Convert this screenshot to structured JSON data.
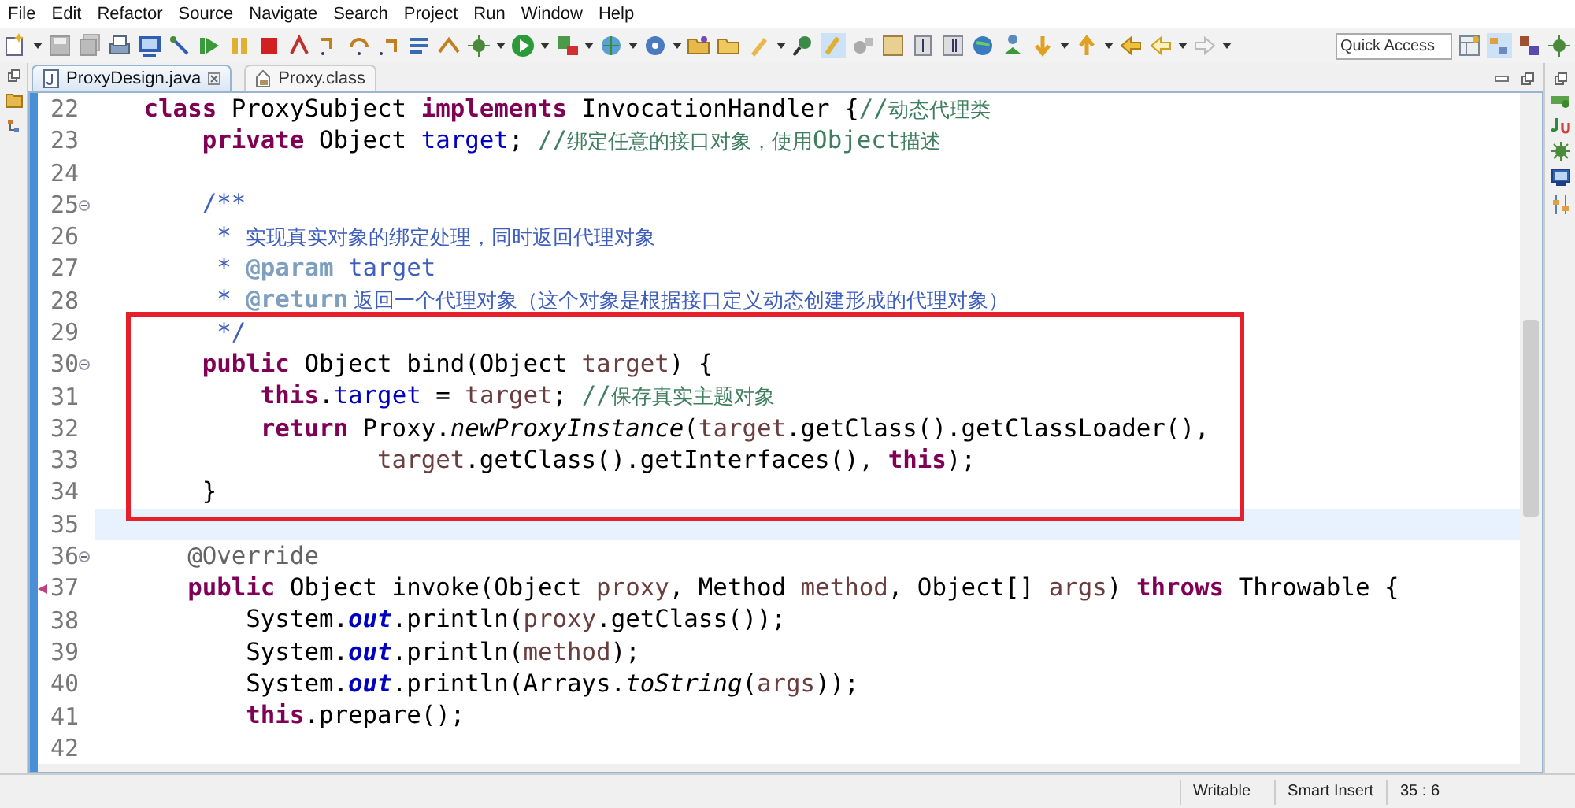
{
  "menu": [
    "File",
    "Edit",
    "Refactor",
    "Source",
    "Navigate",
    "Search",
    "Project",
    "Run",
    "Window",
    "Help"
  ],
  "quick_access": {
    "placeholder": "Quick Access"
  },
  "tabs": [
    {
      "label": "ProxyDesign.java",
      "selected": true,
      "closable": true,
      "kind": "java"
    },
    {
      "label": "Proxy.class",
      "selected": false,
      "closable": false,
      "kind": "class"
    }
  ],
  "editor": {
    "lines": [
      {
        "number": "22",
        "fold": false,
        "override": false,
        "current": false,
        "boxed": false,
        "segments": [
          {
            "kind": "k",
            "text": " class"
          },
          {
            "kind": "p",
            "text": " ProxySubject "
          },
          {
            "kind": "k",
            "text": "implements"
          },
          {
            "kind": "p",
            "text": " InvocationHandler {"
          },
          {
            "kind": "c",
            "text": "//"
          },
          {
            "kind": "cc",
            "text": "动态代理类"
          }
        ]
      },
      {
        "number": "23",
        "fold": false,
        "override": false,
        "current": false,
        "boxed": false,
        "segments": [
          {
            "kind": "k",
            "text": "     private"
          },
          {
            "kind": "p",
            "text": " Object "
          },
          {
            "kind": "f",
            "text": "target"
          },
          {
            "kind": "p",
            "text": "; "
          },
          {
            "kind": "c",
            "text": "//"
          },
          {
            "kind": "cc",
            "text": "绑定任意的接口对象，使用"
          },
          {
            "kind": "c",
            "text": "Object"
          },
          {
            "kind": "cc",
            "text": "描述"
          }
        ]
      },
      {
        "number": "24",
        "fold": false,
        "override": false,
        "current": false,
        "boxed": false
      },
      {
        "number": "25",
        "fold": true,
        "override": false,
        "current": false,
        "boxed": false,
        "segments": [
          {
            "kind": "j",
            "text": "     /**"
          }
        ]
      },
      {
        "number": "26",
        "fold": false,
        "override": false,
        "current": false,
        "boxed": false,
        "segments": [
          {
            "kind": "j",
            "text": "      * "
          },
          {
            "kind": "jc",
            "text": "实现真实对象的绑定处理，同时返回代理对象"
          }
        ]
      },
      {
        "number": "27",
        "fold": false,
        "override": false,
        "current": false,
        "boxed": false,
        "segments": [
          {
            "kind": "j",
            "text": "      * "
          },
          {
            "kind": "jt",
            "text": "@param"
          },
          {
            "kind": "j",
            "text": " target"
          }
        ]
      },
      {
        "number": "28",
        "fold": false,
        "override": false,
        "current": false,
        "boxed": false,
        "segments": [
          {
            "kind": "j",
            "text": "      * "
          },
          {
            "kind": "jt",
            "text": "@return"
          },
          {
            "kind": "jc",
            "text": " 返回一个代理对象（这个对象是根据接口定义动态创建形成的代理对象）"
          }
        ]
      },
      {
        "number": "29",
        "fold": false,
        "override": false,
        "current": false,
        "boxed": true,
        "segments": [
          {
            "kind": "j",
            "text": "      */"
          }
        ]
      },
      {
        "number": "30",
        "fold": true,
        "override": false,
        "current": false,
        "boxed": true,
        "segments": [
          {
            "kind": "k",
            "text": "     public"
          },
          {
            "kind": "p",
            "text": " Object bind(Object "
          },
          {
            "kind": "v",
            "text": "target"
          },
          {
            "kind": "p",
            "text": ") {"
          }
        ]
      },
      {
        "number": "31",
        "fold": false,
        "override": false,
        "current": false,
        "boxed": true,
        "segments": [
          {
            "kind": "k",
            "text": "         this"
          },
          {
            "kind": "p",
            "text": "."
          },
          {
            "kind": "f",
            "text": "target"
          },
          {
            "kind": "p",
            "text": " = "
          },
          {
            "kind": "v",
            "text": "target"
          },
          {
            "kind": "p",
            "text": "; "
          },
          {
            "kind": "c",
            "text": "//"
          },
          {
            "kind": "cc",
            "text": "保存真实主题对象"
          }
        ]
      },
      {
        "number": "32",
        "fold": false,
        "override": false,
        "current": false,
        "boxed": true,
        "segments": [
          {
            "kind": "k",
            "text": "         return"
          },
          {
            "kind": "p",
            "text": " Proxy."
          },
          {
            "kind": "im",
            "text": "newProxyInstance"
          },
          {
            "kind": "p",
            "text": "("
          },
          {
            "kind": "v",
            "text": "target"
          },
          {
            "kind": "p",
            "text": ".getClass().getClassLoader(),"
          }
        ]
      },
      {
        "number": "33",
        "fold": false,
        "override": false,
        "current": false,
        "boxed": true,
        "segments": [
          {
            "kind": "v",
            "text": "                 target"
          },
          {
            "kind": "p",
            "text": ".getClass().getInterfaces(), "
          },
          {
            "kind": "k",
            "text": "this"
          },
          {
            "kind": "p",
            "text": ");"
          }
        ]
      },
      {
        "number": "34",
        "fold": false,
        "override": false,
        "current": false,
        "boxed": true,
        "segments": [
          {
            "kind": "p",
            "text": "     }"
          }
        ]
      },
      {
        "number": "35",
        "fold": false,
        "override": false,
        "current": true,
        "boxed": false
      },
      {
        "number": "36",
        "fold": true,
        "override": false,
        "current": false,
        "boxed": false,
        "segments": [
          {
            "kind": "a",
            "text": "    @Override"
          }
        ]
      },
      {
        "number": "37",
        "fold": false,
        "override": true,
        "current": false,
        "boxed": false,
        "segments": [
          {
            "kind": "k",
            "text": "    public"
          },
          {
            "kind": "p",
            "text": " Object invoke(Object "
          },
          {
            "kind": "v",
            "text": "proxy"
          },
          {
            "kind": "p",
            "text": ", Method "
          },
          {
            "kind": "v",
            "text": "method"
          },
          {
            "kind": "p",
            "text": ", Object[] "
          },
          {
            "kind": "v",
            "text": "args"
          },
          {
            "kind": "p",
            "text": ") "
          },
          {
            "kind": "k",
            "text": "throws"
          },
          {
            "kind": "p",
            "text": " Throwable {"
          }
        ]
      },
      {
        "number": "38",
        "fold": false,
        "override": false,
        "current": false,
        "boxed": false,
        "segments": [
          {
            "kind": "p",
            "text": "        System."
          },
          {
            "kind": "sf",
            "text": "out"
          },
          {
            "kind": "p",
            "text": ".println("
          },
          {
            "kind": "v",
            "text": "proxy"
          },
          {
            "kind": "p",
            "text": ".getClass());"
          }
        ]
      },
      {
        "number": "39",
        "fold": false,
        "override": false,
        "current": false,
        "boxed": false,
        "segments": [
          {
            "kind": "p",
            "text": "        System."
          },
          {
            "kind": "sf",
            "text": "out"
          },
          {
            "kind": "p",
            "text": ".println("
          },
          {
            "kind": "v",
            "text": "method"
          },
          {
            "kind": "p",
            "text": ");"
          }
        ]
      },
      {
        "number": "40",
        "fold": false,
        "override": false,
        "current": false,
        "boxed": false,
        "segments": [
          {
            "kind": "p",
            "text": "        System."
          },
          {
            "kind": "sf",
            "text": "out"
          },
          {
            "kind": "p",
            "text": ".println(Arrays."
          },
          {
            "kind": "im",
            "text": "toString"
          },
          {
            "kind": "p",
            "text": "("
          },
          {
            "kind": "v",
            "text": "args"
          },
          {
            "kind": "p",
            "text": "));"
          }
        ]
      },
      {
        "number": "41",
        "fold": false,
        "override": false,
        "current": false,
        "boxed": false,
        "segments": [
          {
            "kind": "k",
            "text": "        this"
          },
          {
            "kind": "p",
            "text": ".prepare();"
          }
        ]
      },
      {
        "number": "42",
        "fold": false,
        "override": false,
        "current": false,
        "boxed": false
      }
    ]
  },
  "status_bar": [
    "Writable",
    "Smart Insert",
    "35 : 6"
  ]
}
